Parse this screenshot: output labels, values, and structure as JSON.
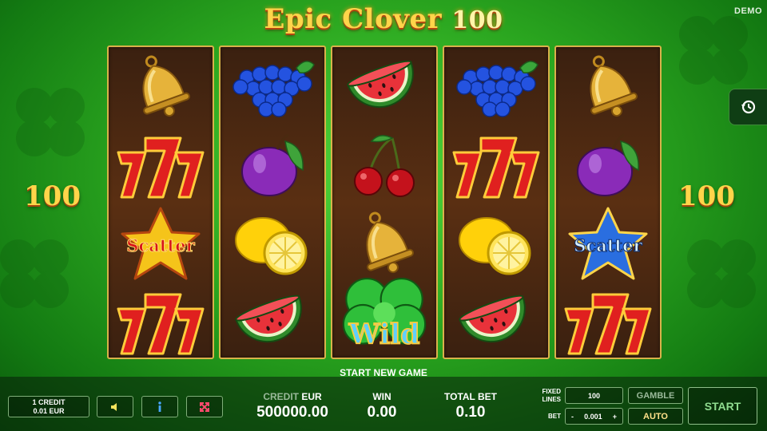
{
  "header": {
    "title_main": "Epic Clover",
    "title_num": "100",
    "demo": "DEMO"
  },
  "lines_left": "100",
  "lines_right": "100",
  "reels": [
    [
      "bell",
      "seven",
      "scatter-red",
      "seven"
    ],
    [
      "grapes",
      "plum",
      "lemon",
      "watermelon"
    ],
    [
      "watermelon",
      "cherries",
      "bell",
      "wild"
    ],
    [
      "grapes",
      "seven",
      "lemon",
      "watermelon"
    ],
    [
      "bell",
      "plum",
      "scatter-blue",
      "seven"
    ]
  ],
  "symbols": {
    "scatter": "Scatter",
    "wild": "Wild"
  },
  "start_new_game": "START NEW GAME",
  "bottom": {
    "credit_line1": "1 CREDIT",
    "credit_line2": "0.01 EUR",
    "credit_label": "CREDIT",
    "credit_unit": "EUR",
    "credit_value": "500000.00",
    "win_label": "WIN",
    "win_value": "0.00",
    "total_bet_label": "TOTAL BET",
    "total_bet_value": "0.10",
    "fixed_lines_label1": "FIXED",
    "fixed_lines_label2": "LINES",
    "lines_value": "100",
    "bet_label": "BET",
    "bet_minus": "-",
    "bet_value": "0.001",
    "bet_plus": "+",
    "gamble": "GAMBLE",
    "auto": "AUTO",
    "start": "START"
  },
  "icons": {
    "sound": "speaker-icon",
    "info": "info-icon",
    "fullscreen": "fullscreen-icon",
    "history": "history-icon"
  },
  "colors": {
    "accent_gold": "#ffd54a",
    "reel_bg": "#4a2812",
    "bg_green": "#2aa51f"
  }
}
